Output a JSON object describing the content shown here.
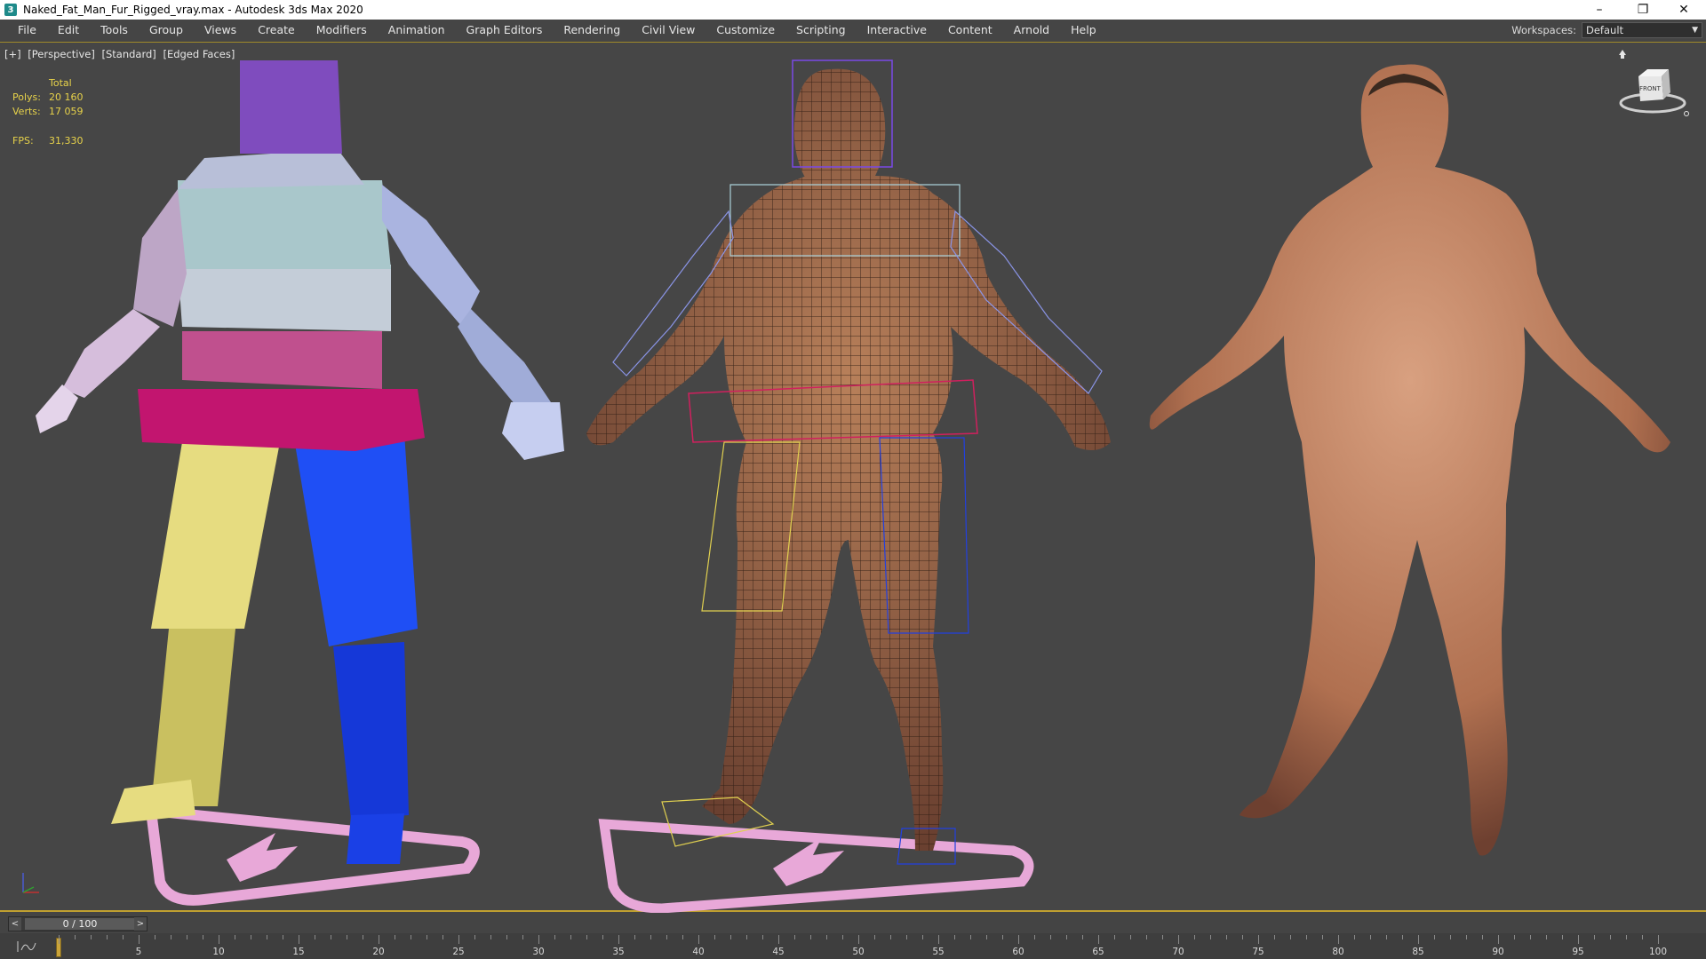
{
  "window": {
    "title": "Naked_Fat_Man_Fur_Rigged_vray.max - Autodesk 3ds Max 2020",
    "minimize": "–",
    "maximize": "❐",
    "close": "✕",
    "icon": "3ds-max-icon"
  },
  "menu": {
    "items": [
      {
        "label": "File"
      },
      {
        "label": "Edit"
      },
      {
        "label": "Tools"
      },
      {
        "label": "Group"
      },
      {
        "label": "Views"
      },
      {
        "label": "Create"
      },
      {
        "label": "Modifiers"
      },
      {
        "label": "Animation"
      },
      {
        "label": "Graph Editors"
      },
      {
        "label": "Rendering"
      },
      {
        "label": "Civil View"
      },
      {
        "label": "Customize"
      },
      {
        "label": "Scripting"
      },
      {
        "label": "Interactive"
      },
      {
        "label": "Content"
      },
      {
        "label": "Arnold"
      },
      {
        "label": "Help"
      }
    ]
  },
  "workspace": {
    "label": "Workspaces:",
    "value": "Default"
  },
  "viewport": {
    "labels": [
      "[+]",
      "[Perspective]",
      "[Standard]",
      "[Edged Faces]"
    ],
    "stats": {
      "header": "Total",
      "polys_label": "Polys:",
      "polys": "20 160",
      "verts_label": "Verts:",
      "verts": "17 059",
      "fps_label": "FPS:",
      "fps": "31,330"
    },
    "viewcube_label": "FRONT",
    "colors": {
      "background": "#464646",
      "skin": "#b67a5a",
      "bone_head": "#7a49b6",
      "bone_torso": "#a9c5cb",
      "bone_arm": "#aab4dc",
      "bone_pelvis": "#c2156f",
      "bone_leg_left": "#e0d67a",
      "bone_leg_right": "#1a3fe0",
      "footstep": "#e8a8d8"
    }
  },
  "timeline": {
    "slider_value": "0 / 100",
    "prev": "<",
    "next": ">",
    "ticks": [
      "5",
      "10",
      "15",
      "20",
      "25",
      "30",
      "35",
      "40",
      "45",
      "50",
      "55",
      "60",
      "65",
      "70",
      "75",
      "80",
      "85",
      "90",
      "95",
      "100"
    ]
  }
}
